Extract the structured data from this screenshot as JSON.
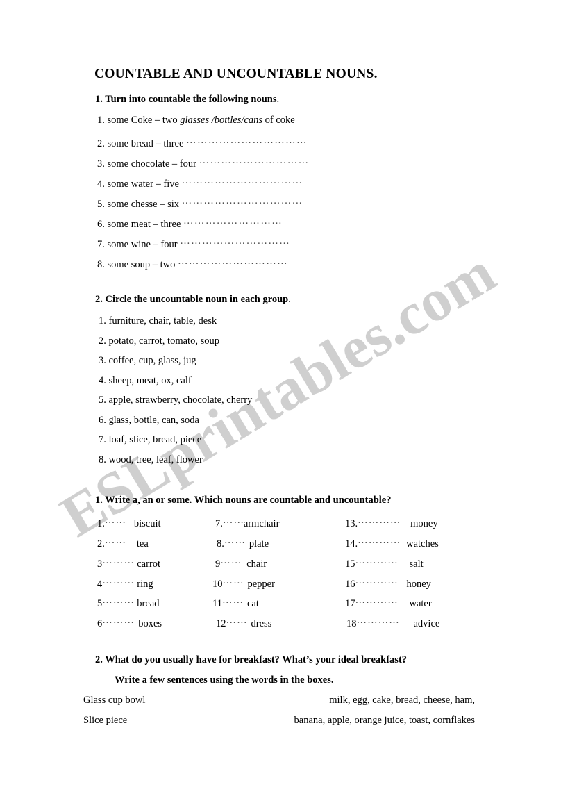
{
  "watermark": {
    "text": "ESLprintables.com",
    "color": "#cfcfcf"
  },
  "document": {
    "title": "COUNTABLE AND UNCOUNTABLE NOUNS."
  },
  "exercise1": {
    "heading_bold": "1. Turn into countable the following nouns",
    "heading_trail": ".",
    "items": [
      {
        "prompt": "1. some Coke – two ",
        "answer_italic": "glasses /bottles/cans",
        "answer_tail": " of coke",
        "dots": ""
      },
      {
        "prompt": "2. some bread – three ",
        "answer_italic": "",
        "answer_tail": "",
        "dots": "……………………………"
      },
      {
        "prompt": "3. some chocolate – four ",
        "answer_italic": "",
        "answer_tail": "",
        "dots": "…………………………"
      },
      {
        "prompt": "4. some water – five ",
        "answer_italic": "",
        "answer_tail": "",
        "dots": "……………………………"
      },
      {
        "prompt": "5. some chesse – six ",
        "answer_italic": "",
        "answer_tail": "",
        "dots": "……………………………"
      },
      {
        "prompt": "6. some meat – three ",
        "answer_italic": "",
        "answer_tail": "",
        "dots": "………………………"
      },
      {
        "prompt": "7. some wine – four ",
        "answer_italic": "",
        "answer_tail": "",
        "dots": "…………………………"
      },
      {
        "prompt": "8. some soup – two ",
        "answer_italic": "",
        "answer_tail": "",
        "dots": "…………………………"
      }
    ]
  },
  "exercise2": {
    "heading_bold": "2. Circle the uncountable noun in each group",
    "heading_trail": ".",
    "items": [
      "1. furniture, chair, table, desk",
      "2. potato, carrot, tomato, soup",
      "3. coffee, cup, glass, jug",
      "4. sheep, meat, ox, calf",
      "5. apple, strawberry, chocolate, cherry",
      "6. glass, bottle, can, soda",
      "7. loaf, slice, bread, piece",
      "8. wood, tree, leaf, flower"
    ]
  },
  "exercise3": {
    "heading": "1.   Write a, an or some. Which nouns are countable and uncountable?",
    "column1": [
      {
        "num": "1.",
        "dots": "……",
        "word": "biscuit"
      },
      {
        "num": "2.",
        "dots": "……",
        "word": "tea"
      },
      {
        "num": "3",
        "dots": "………",
        "word": "carrot"
      },
      {
        "num": "4",
        "dots": "………",
        "word": "ring"
      },
      {
        "num": "5",
        "dots": "………",
        "word": "bread"
      },
      {
        "num": "6",
        "dots": "………",
        "word": "boxes"
      }
    ],
    "column2": [
      {
        "num": "7.",
        "dots": "……",
        "word": "armchair"
      },
      {
        "num": "8.",
        "dots": "……",
        "word": "plate"
      },
      {
        "num": "9",
        "dots": "……",
        "word": "chair"
      },
      {
        "num": "10",
        "dots": "……",
        "word": "pepper"
      },
      {
        "num": "11",
        "dots": "……",
        "word": "cat"
      },
      {
        "num": "12",
        "dots": "……",
        "word": "dress"
      }
    ],
    "column3": [
      {
        "num": "13.",
        "dots": "…………",
        "word": "money"
      },
      {
        "num": "14.",
        "dots": "…………",
        "word": "watches"
      },
      {
        "num": "15",
        "dots": "…………",
        "word": "salt"
      },
      {
        "num": "16",
        "dots": "…………",
        "word": "honey"
      },
      {
        "num": "17",
        "dots": "…………",
        "word": "water"
      },
      {
        "num": "18",
        "dots": "…………",
        "word": "advice"
      }
    ]
  },
  "exercise4": {
    "heading_line1": "2.   What do you usually have for breakfast? What’s your ideal breakfast?",
    "heading_line2": "Write a few sentences using the words in the boxes.",
    "box_left": [
      "Glass  cup   bowl",
      "Slice   piece"
    ],
    "box_right": [
      "milk, egg, cake, bread, cheese, ham,",
      "banana, apple, orange juice, toast, cornflakes"
    ]
  }
}
